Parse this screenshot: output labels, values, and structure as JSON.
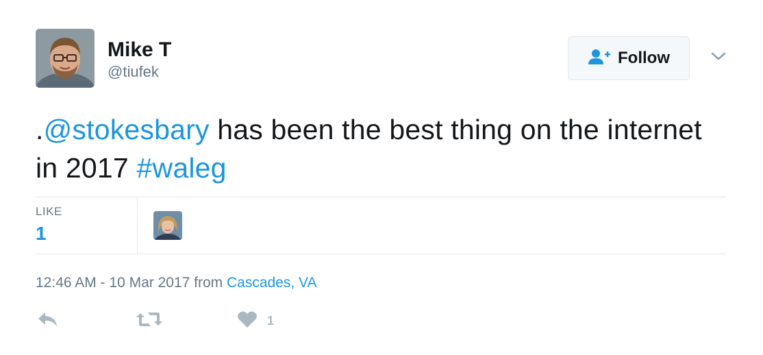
{
  "user": {
    "name": "Mike T",
    "handle": "@tiufek"
  },
  "follow_button": {
    "label": "Follow"
  },
  "tweet": {
    "text_prefix": ".",
    "mention": "@stokesbary",
    "text_middle": " has been the best thing on the internet in 2017 ",
    "hashtag": "#waleg"
  },
  "stats": {
    "like_label": "LIKE",
    "like_count": "1"
  },
  "meta": {
    "timestamp": "12:46 AM - 10 Mar 2017 from ",
    "location": "Cascades, VA"
  },
  "actions": {
    "like_count": "1"
  },
  "colors": {
    "link": "#1b95e0",
    "secondary_text": "#657786",
    "action_icon": "#aab8c2"
  },
  "icons": {
    "follow": "add-user-icon",
    "menu": "chevron-down-icon",
    "reply": "reply-icon",
    "retweet": "retweet-icon",
    "like": "heart-icon"
  }
}
